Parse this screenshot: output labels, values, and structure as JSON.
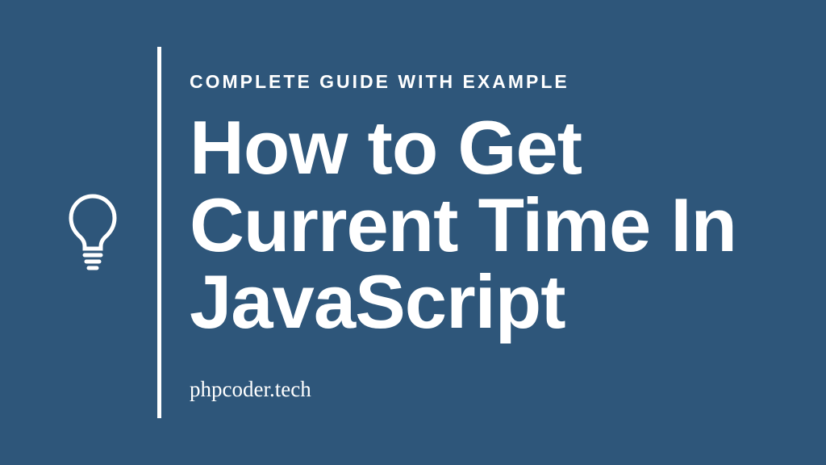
{
  "subtitle": "COMPLETE GUIDE WITH EXAMPLE",
  "title": "How to Get Current Time In JavaScript",
  "website": "phpcoder.tech",
  "colors": {
    "background": "#2e567a",
    "text": "#ffffff"
  }
}
